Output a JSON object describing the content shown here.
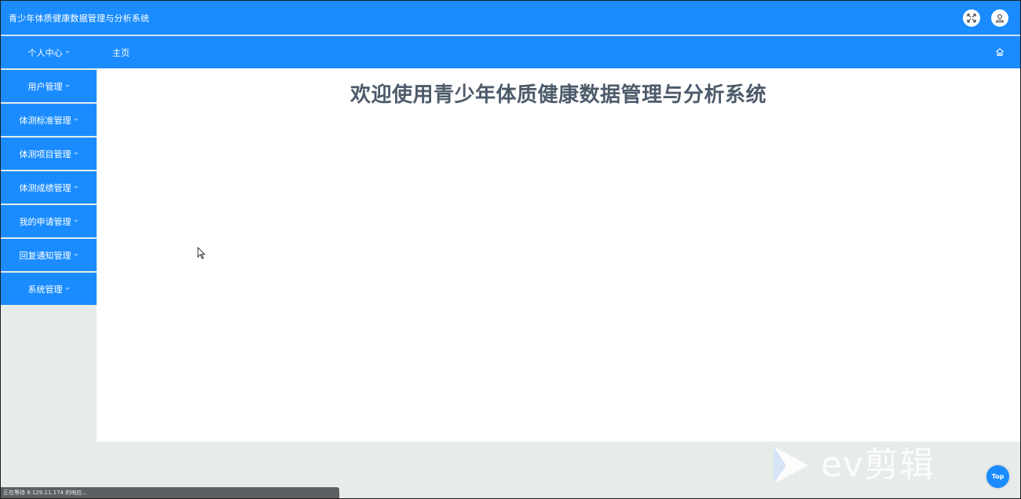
{
  "header": {
    "title": "青少年体质健康数据管理与分析系统",
    "fullscreen_icon": "fullscreen-icon",
    "user_icon": "user-icon"
  },
  "navbar": {
    "user_center": "个人中心",
    "breadcrumb": "主页",
    "home_icon": "home-icon"
  },
  "sidebar": {
    "items": [
      {
        "label": "用户管理"
      },
      {
        "label": "体测标准管理"
      },
      {
        "label": "体测项目管理"
      },
      {
        "label": "体测成绩管理"
      },
      {
        "label": "我的申请管理"
      },
      {
        "label": "回复通知管理"
      },
      {
        "label": "系统管理"
      }
    ]
  },
  "main": {
    "welcome": "欢迎使用青少年体质健康数据管理与分析系统"
  },
  "status_bar": {
    "text": "正在等待 8.129.11.174 的响应..."
  },
  "watermark": {
    "text": "ev剪辑"
  },
  "back_to_top": {
    "label": "Top"
  },
  "colors": {
    "primary": "#1a8cff",
    "background": "#e6ece9",
    "welcome_text": "#4d5b6b"
  }
}
